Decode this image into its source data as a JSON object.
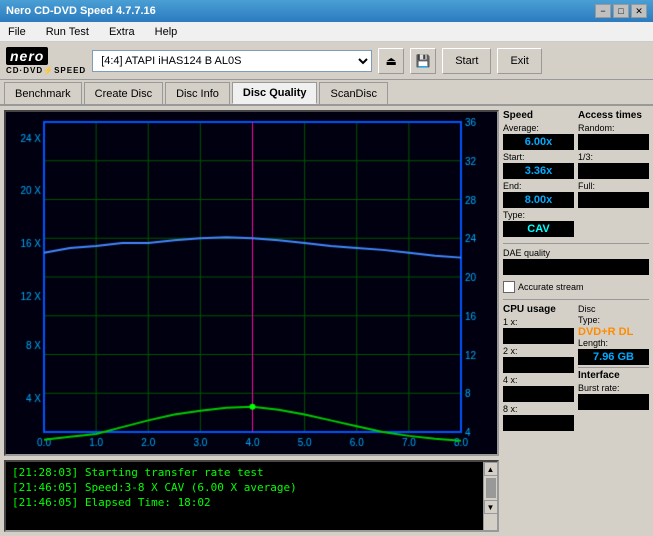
{
  "window": {
    "title": "Nero CD-DVD Speed 4.7.7.16",
    "min_btn": "−",
    "max_btn": "□",
    "close_btn": "✕"
  },
  "menu": {
    "items": [
      "File",
      "Run Test",
      "Extra",
      "Help"
    ]
  },
  "toolbar": {
    "device": "[4:4]  ATAPI iHAS124  B AL0S",
    "start_label": "Start",
    "exit_label": "Exit"
  },
  "tabs": [
    {
      "label": "Benchmark",
      "active": false
    },
    {
      "label": "Create Disc",
      "active": false
    },
    {
      "label": "Disc Info",
      "active": false
    },
    {
      "label": "Disc Quality",
      "active": true
    },
    {
      "label": "ScanDisc",
      "active": false
    }
  ],
  "chart": {
    "x_labels": [
      "0.0",
      "1.0",
      "2.0",
      "3.0",
      "4.0",
      "5.0",
      "6.0",
      "7.0",
      "8.0"
    ],
    "y_left_labels": [
      "4 X",
      "8 X",
      "12 X",
      "16 X",
      "20 X",
      "24 X"
    ],
    "y_right_labels": [
      "4",
      "8",
      "12",
      "16",
      "20",
      "24",
      "28",
      "32",
      "36"
    ],
    "grid_color": "#004400",
    "line_color_blue": "#4444ff",
    "line_color_green": "#00cc00",
    "line_color_magenta": "#cc00cc"
  },
  "speed_panel": {
    "title": "Speed",
    "average_label": "Average:",
    "average_value": "6.00x",
    "start_label": "Start:",
    "start_value": "3.36x",
    "end_label": "End:",
    "end_value": "8.00x",
    "type_label": "Type:",
    "type_value": "CAV"
  },
  "access_panel": {
    "title": "Access times",
    "random_label": "Random:",
    "random_value": "",
    "one_third_label": "1/3:",
    "one_third_value": "",
    "full_label": "Full:",
    "full_value": ""
  },
  "dae_panel": {
    "title": "DAE quality",
    "value": ""
  },
  "cpu_panel": {
    "title": "CPU usage",
    "1x_label": "1 x:",
    "1x_value": "",
    "2x_label": "2 x:",
    "2x_value": "",
    "4x_label": "4 x:",
    "4x_value": "",
    "8x_label": "8 x:",
    "8x_value": ""
  },
  "accurate_stream": {
    "label": "Accurate stream"
  },
  "disc_panel": {
    "type_label": "Disc",
    "type_sub": "Type:",
    "type_value": "DVD+R DL",
    "length_label": "Length:",
    "length_value": "7.96 GB"
  },
  "interface_panel": {
    "title": "Interface",
    "burst_label": "Burst rate:",
    "burst_value": ""
  },
  "log": {
    "lines": [
      "[21:28:03]  Starting transfer rate test",
      "[21:46:05]  Speed:3-8 X CAV (6.00 X average)",
      "[21:46:05]  Elapsed Time: 18:02"
    ]
  }
}
